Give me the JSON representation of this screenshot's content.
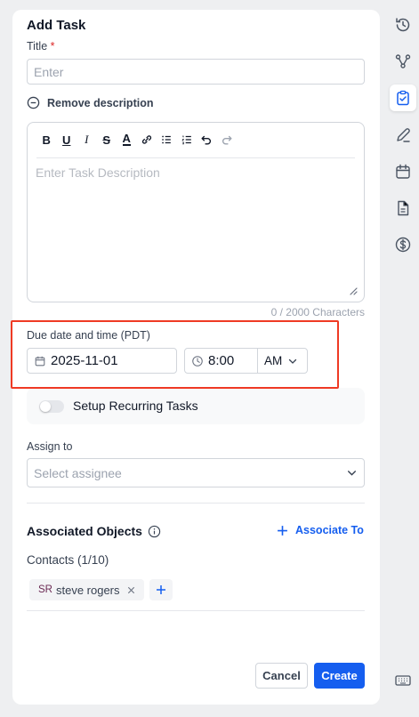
{
  "form": {
    "heading": "Add Task",
    "title_label": "Title",
    "required_mark": "*",
    "title_placeholder": "Enter",
    "remove_description": "Remove description",
    "description_placeholder": "Enter Task Description",
    "char_counter": "0 / 2000 Characters",
    "due_label": "Due date and time (PDT)",
    "due_date": "2025-11-01",
    "due_time": "8:00",
    "due_ampm": "AM",
    "recurring_label": "Setup Recurring Tasks",
    "recurring_on": false,
    "assign_label": "Assign to",
    "assign_placeholder": "Select assignee",
    "associated_title": "Associated Objects",
    "associate_link": "Associate To",
    "contacts_label": "Contacts (1/10)",
    "contacts": [
      {
        "initials": "SR",
        "name": "steve rogers"
      }
    ],
    "cancel_label": "Cancel",
    "create_label": "Create"
  },
  "toolbar": [
    "bold",
    "underline",
    "italic",
    "strikethrough",
    "text-color",
    "link",
    "bullet-list",
    "numbered-list",
    "undo",
    "redo"
  ],
  "rail": [
    "history-icon",
    "workflow-icon",
    "tasks-icon",
    "pen-icon",
    "calendar-icon",
    "document-icon",
    "dollar-icon",
    "keyboard-icon"
  ],
  "colors": {
    "primary": "#155eef",
    "highlight": "#ef3a24",
    "initials": "#6b2a54"
  }
}
